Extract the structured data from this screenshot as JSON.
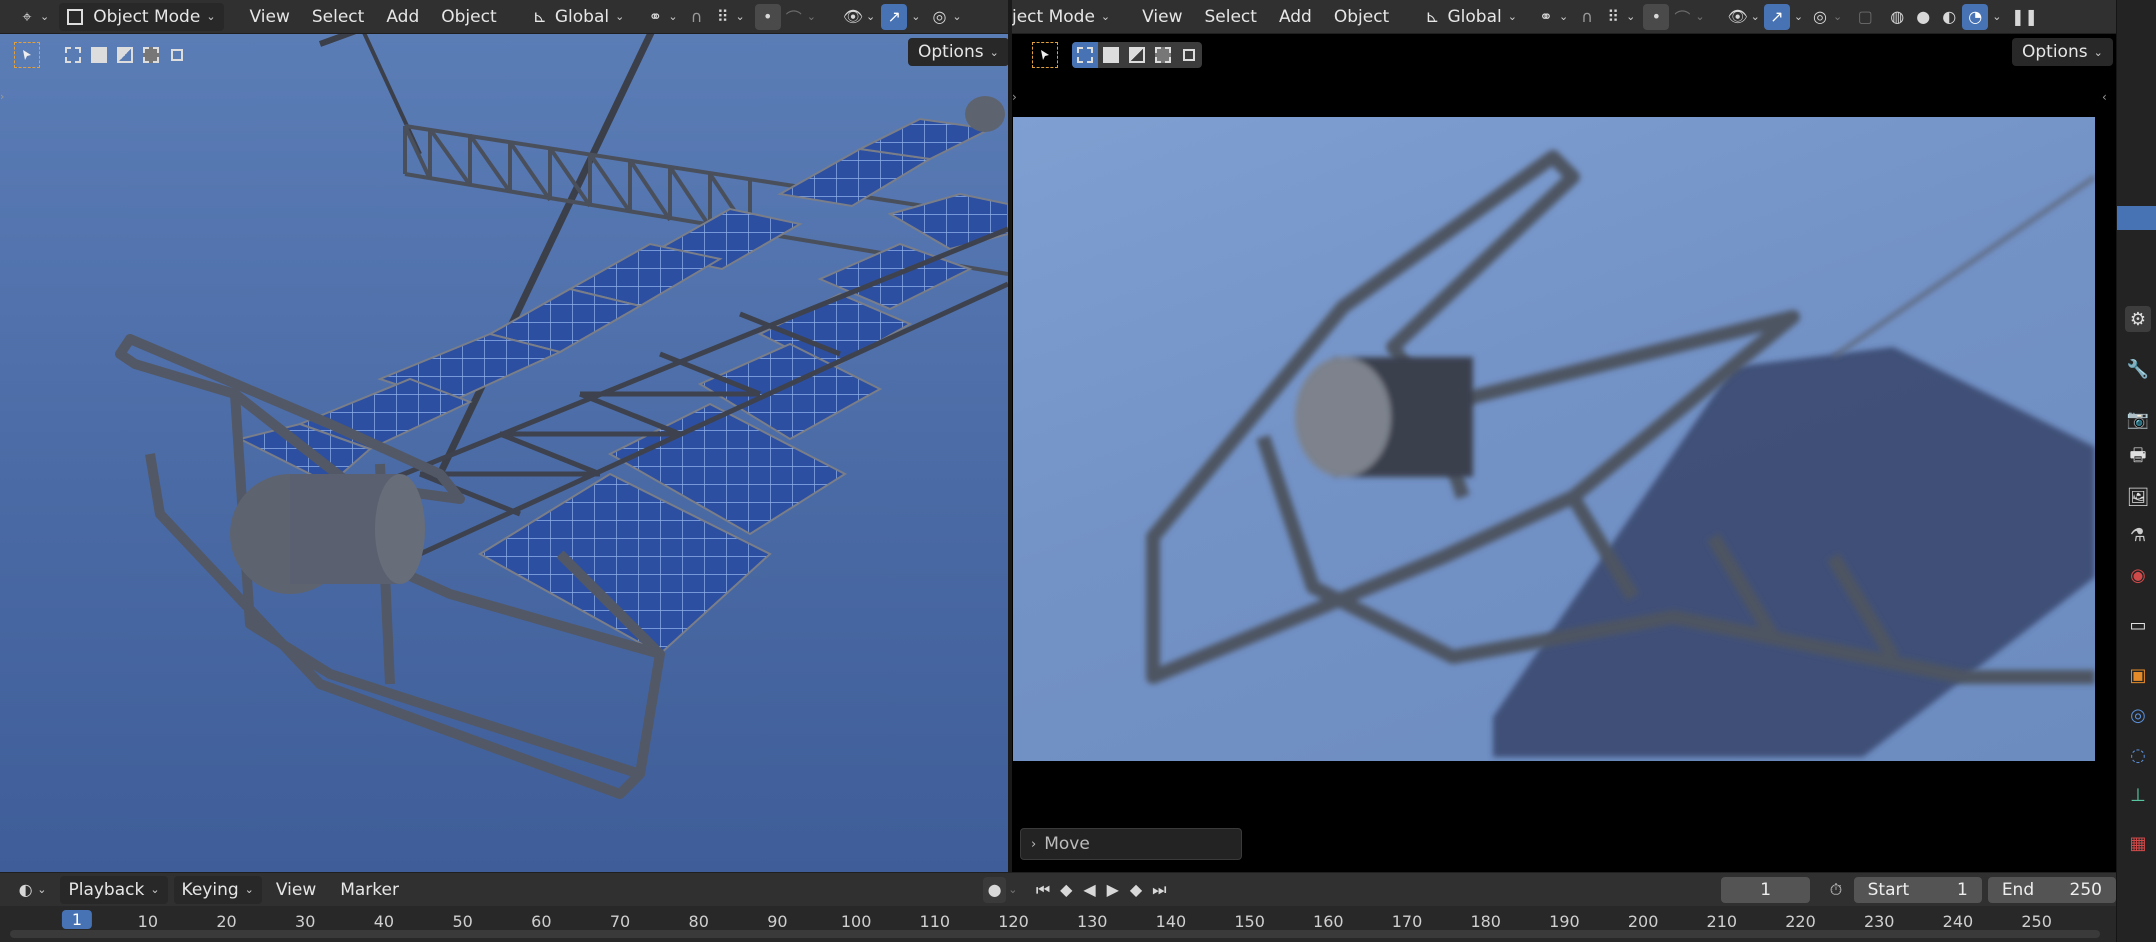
{
  "left_header": {
    "mode": "Object Mode",
    "menus": [
      "View",
      "Select",
      "Add",
      "Object"
    ],
    "transform": "Global"
  },
  "right_header": {
    "mode": "ject Mode",
    "menus": [
      "View",
      "Select",
      "Add",
      "Object"
    ],
    "transform": "Global"
  },
  "left_viewport": {
    "options_label": "Options"
  },
  "right_viewport": {
    "options_label": "Options",
    "operator_panel": "Move"
  },
  "timeline": {
    "menus": [
      "Playback",
      "Keying",
      "View",
      "Marker"
    ],
    "current_frame": "1",
    "start_label": "Start",
    "start_value": "1",
    "end_label": "End",
    "end_value": "250",
    "ticks": [
      "1",
      "10",
      "20",
      "30",
      "40",
      "50",
      "60",
      "70",
      "80",
      "90",
      "100",
      "110",
      "120",
      "130",
      "140",
      "150",
      "160",
      "170",
      "180",
      "190",
      "200",
      "210",
      "220",
      "230",
      "240",
      "250"
    ],
    "playhead_frame": "1"
  },
  "colors": {
    "accent": "#4772b3",
    "header_bg": "#303030",
    "viewport_sky_top": "#5a7bb4",
    "viewport_sky_bottom": "#3d5a92",
    "render_bg": "#7897c9",
    "panel_blue": "#2d4fa2"
  },
  "icons": {
    "editor_type": "editor-type-icon",
    "timeline_editor": "clock-icon",
    "sidebar": [
      "tool-icon",
      "render-icon",
      "output-icon",
      "view-layer-icon",
      "scene-icon",
      "world-icon",
      "collection-icon",
      "object-icon",
      "modifier-icon",
      "particles-icon",
      "physics-icon",
      "constraints-icon",
      "data-icon",
      "texture-icon"
    ]
  }
}
